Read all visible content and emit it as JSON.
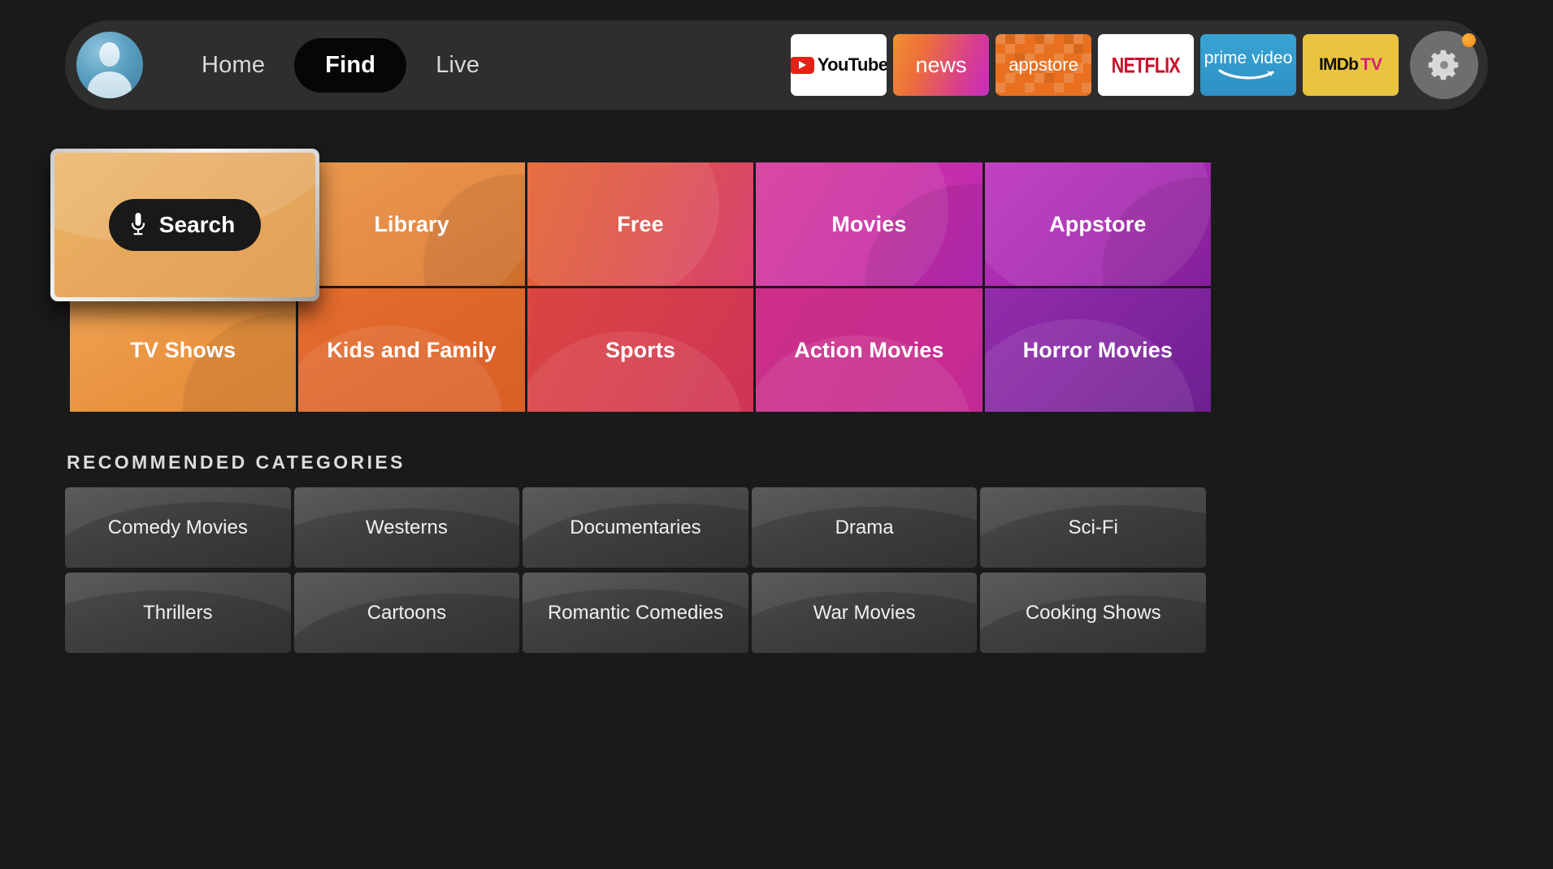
{
  "nav": {
    "avatar_name": "user-avatar",
    "links": [
      {
        "label": "Home",
        "active": false
      },
      {
        "label": "Find",
        "active": true
      },
      {
        "label": "Live",
        "active": false
      }
    ],
    "apps": [
      {
        "name": "youtube",
        "label": "YouTube"
      },
      {
        "name": "news",
        "label": "news"
      },
      {
        "name": "appstore",
        "label": "appstore"
      },
      {
        "name": "netflix",
        "label": "NETFLIX"
      },
      {
        "name": "prime-video",
        "label": "prime video"
      },
      {
        "name": "imdb-tv",
        "label": "IMDb",
        "label2": "TV"
      }
    ],
    "settings_label": "Settings",
    "notification": true
  },
  "search": {
    "label": "Search",
    "focused": true,
    "icon": "microphone-icon"
  },
  "tiles": [
    {
      "label": "Search",
      "color_from": "#eeb567",
      "color_to": "#e0a257",
      "focused": true
    },
    {
      "label": "Library",
      "color_from": "#e8903c",
      "color_to": "#e07a33",
      "focused": false
    },
    {
      "label": "Free",
      "color_from": "#e4622f",
      "color_to": "#d94272",
      "focused": false
    },
    {
      "label": "Movies",
      "color_from": "#d6389a",
      "color_to": "#b92ab8",
      "focused": false
    },
    {
      "label": "Appstore",
      "color_from": "#b82fbc",
      "color_to": "#8e23a8",
      "focused": false
    },
    {
      "label": "TV Shows",
      "color_from": "#eea martin",
      "color_to": "#e58b3c",
      "focused": false
    },
    {
      "label": "Kids and Family",
      "color_from": "#e2692c",
      "color_to": "#d9632c",
      "focused": false
    },
    {
      "label": "Sports",
      "color_from": "#d9403f",
      "color_to": "#cf3358",
      "focused": false
    },
    {
      "label": "Action Movies",
      "color_from": "#cc2d86",
      "color_to": "#c62a92",
      "focused": false
    },
    {
      "label": "Horror Movies",
      "color_from": "#8e2aa8",
      "color_to": "#6d2090",
      "focused": false
    }
  ],
  "recommended": {
    "section_title": "RECOMMENDED CATEGORIES",
    "cards": [
      {
        "label": "Comedy Movies"
      },
      {
        "label": "Westerns"
      },
      {
        "label": "Documentaries"
      },
      {
        "label": "Drama"
      },
      {
        "label": "Sci-Fi"
      },
      {
        "label": "Thrillers"
      },
      {
        "label": "Cartoons"
      },
      {
        "label": "Romantic Comedies"
      },
      {
        "label": "War Movies"
      },
      {
        "label": "Cooking Shows"
      }
    ]
  },
  "colors": {
    "background": "#1a1a1a",
    "navbar": "#2e2e2e",
    "active_pill": "#060606",
    "accent_orange": "#ef8a15",
    "focus_border": "#f2f2f2"
  }
}
